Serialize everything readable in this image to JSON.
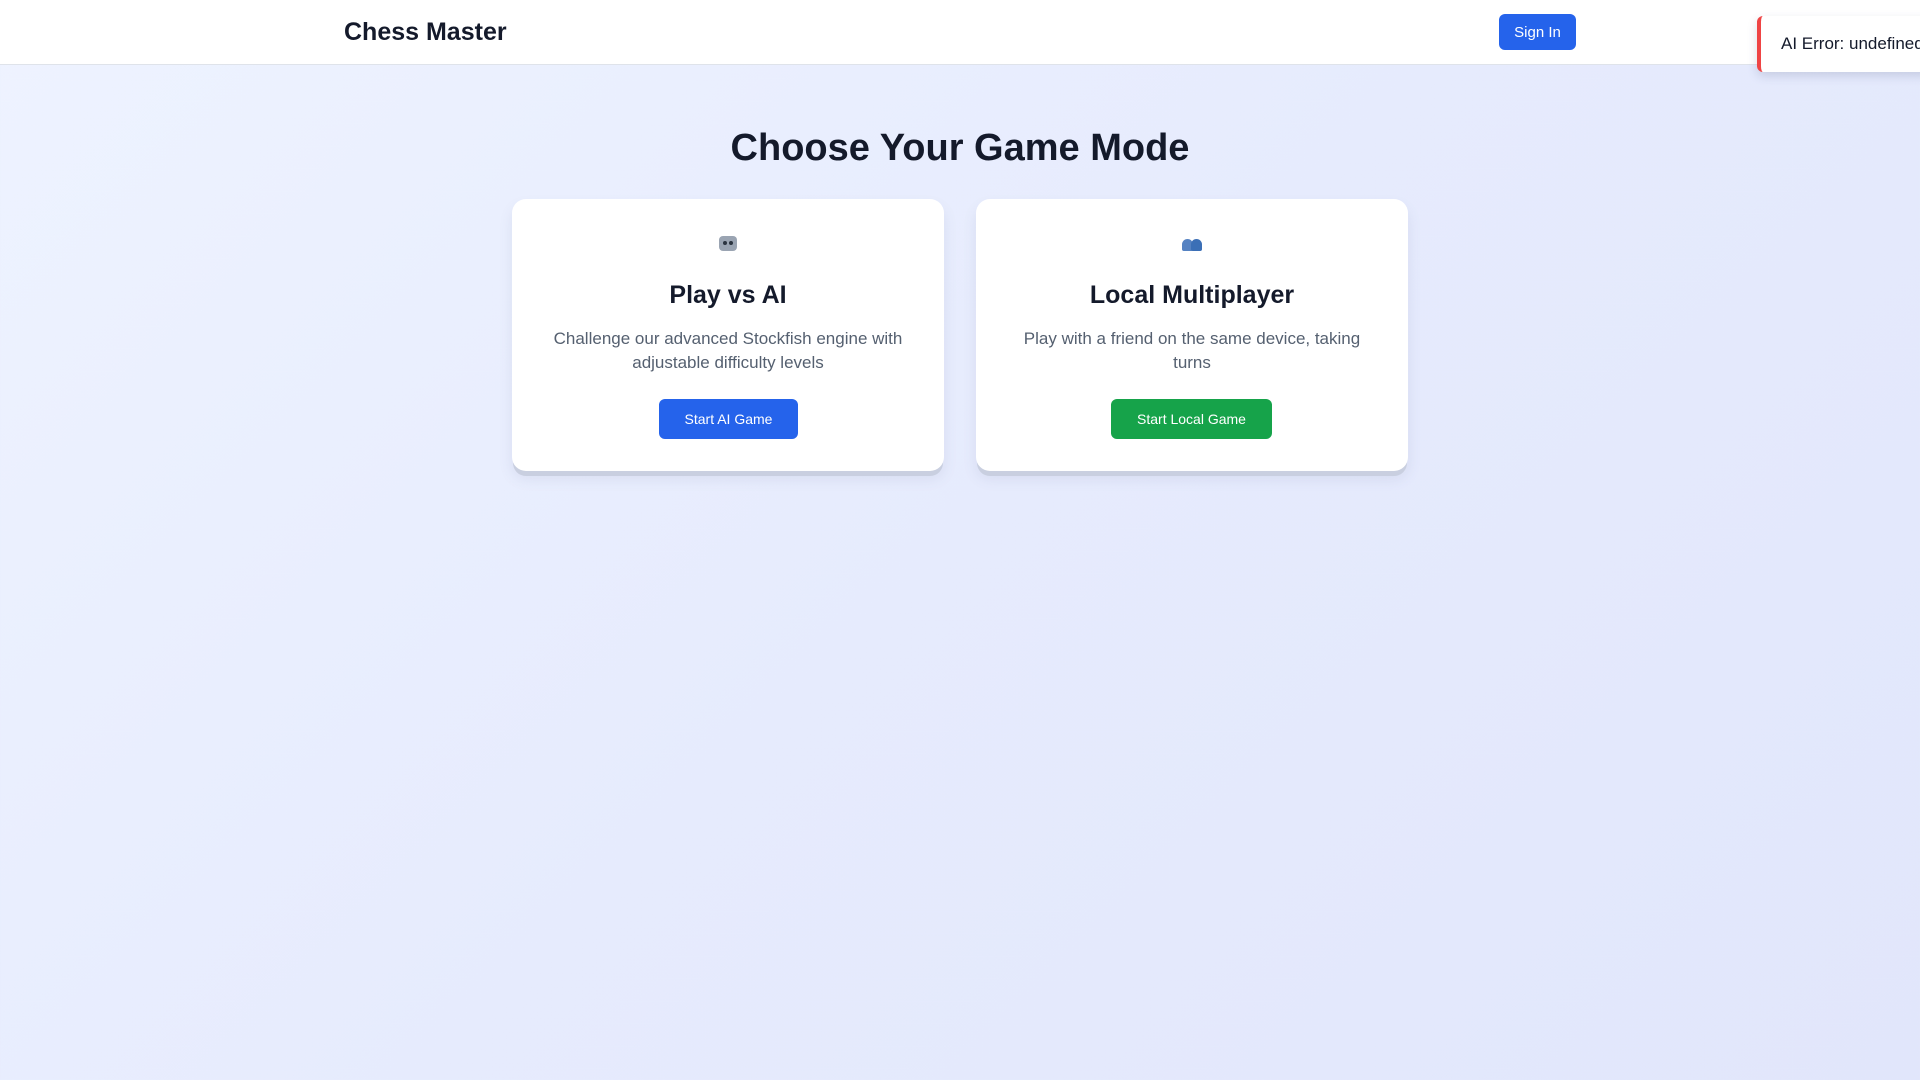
{
  "header": {
    "brand": "Chess Master",
    "sign_in_label": "Sign In"
  },
  "toast": {
    "message": "AI Error: undefined",
    "accent_color": "#ef4444"
  },
  "main": {
    "title": "Choose Your Game Mode",
    "modes": [
      {
        "icon": "robot-icon",
        "title": "Play vs AI",
        "description": "Challenge our advanced Stockfish engine with adjustable difficulty levels",
        "button_label": "Start AI Game",
        "button_color": "#2563eb"
      },
      {
        "icon": "people-icon",
        "title": "Local Multiplayer",
        "description": "Play with a friend on the same device, taking turns",
        "button_label": "Start Local Game",
        "button_color": "#16a34a"
      }
    ]
  }
}
